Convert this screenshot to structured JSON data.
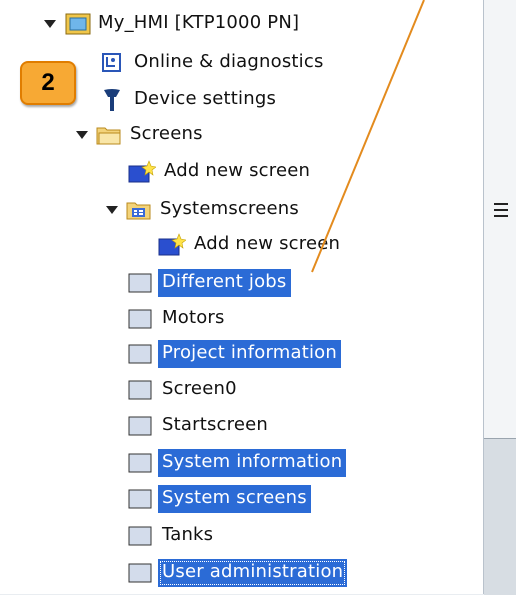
{
  "badge": "2",
  "colors": {
    "selection": "#2b6bd6",
    "callout": "#f7a934",
    "callout_border": "#e07d00",
    "pointer": "#e38b1e"
  },
  "tree": {
    "device": "My_HMI [KTP1000 PN]",
    "online": "Online & diagnostics",
    "device_settings": "Device settings",
    "screens": "Screens",
    "add_new_screen": "Add new screen",
    "systemscreens": "Systemscreens",
    "add_new_screen_sys": "Add new screen",
    "items": [
      {
        "label": "Different jobs",
        "selected": true
      },
      {
        "label": "Motors",
        "selected": false
      },
      {
        "label": "Project information",
        "selected": true
      },
      {
        "label": "Screen0",
        "selected": false
      },
      {
        "label": "Startscreen",
        "selected": false
      },
      {
        "label": "System information",
        "selected": true
      },
      {
        "label": "System screens",
        "selected": true
      },
      {
        "label": "Tanks",
        "selected": false
      },
      {
        "label": "User administration",
        "selected": true
      }
    ]
  },
  "icons": {
    "device": "hmi-device-icon",
    "online": "online-diagnostics-icon",
    "settings": "wrench-icon",
    "folder": "folder-icon",
    "add": "add-screen-icon",
    "screen": "screen-icon"
  }
}
